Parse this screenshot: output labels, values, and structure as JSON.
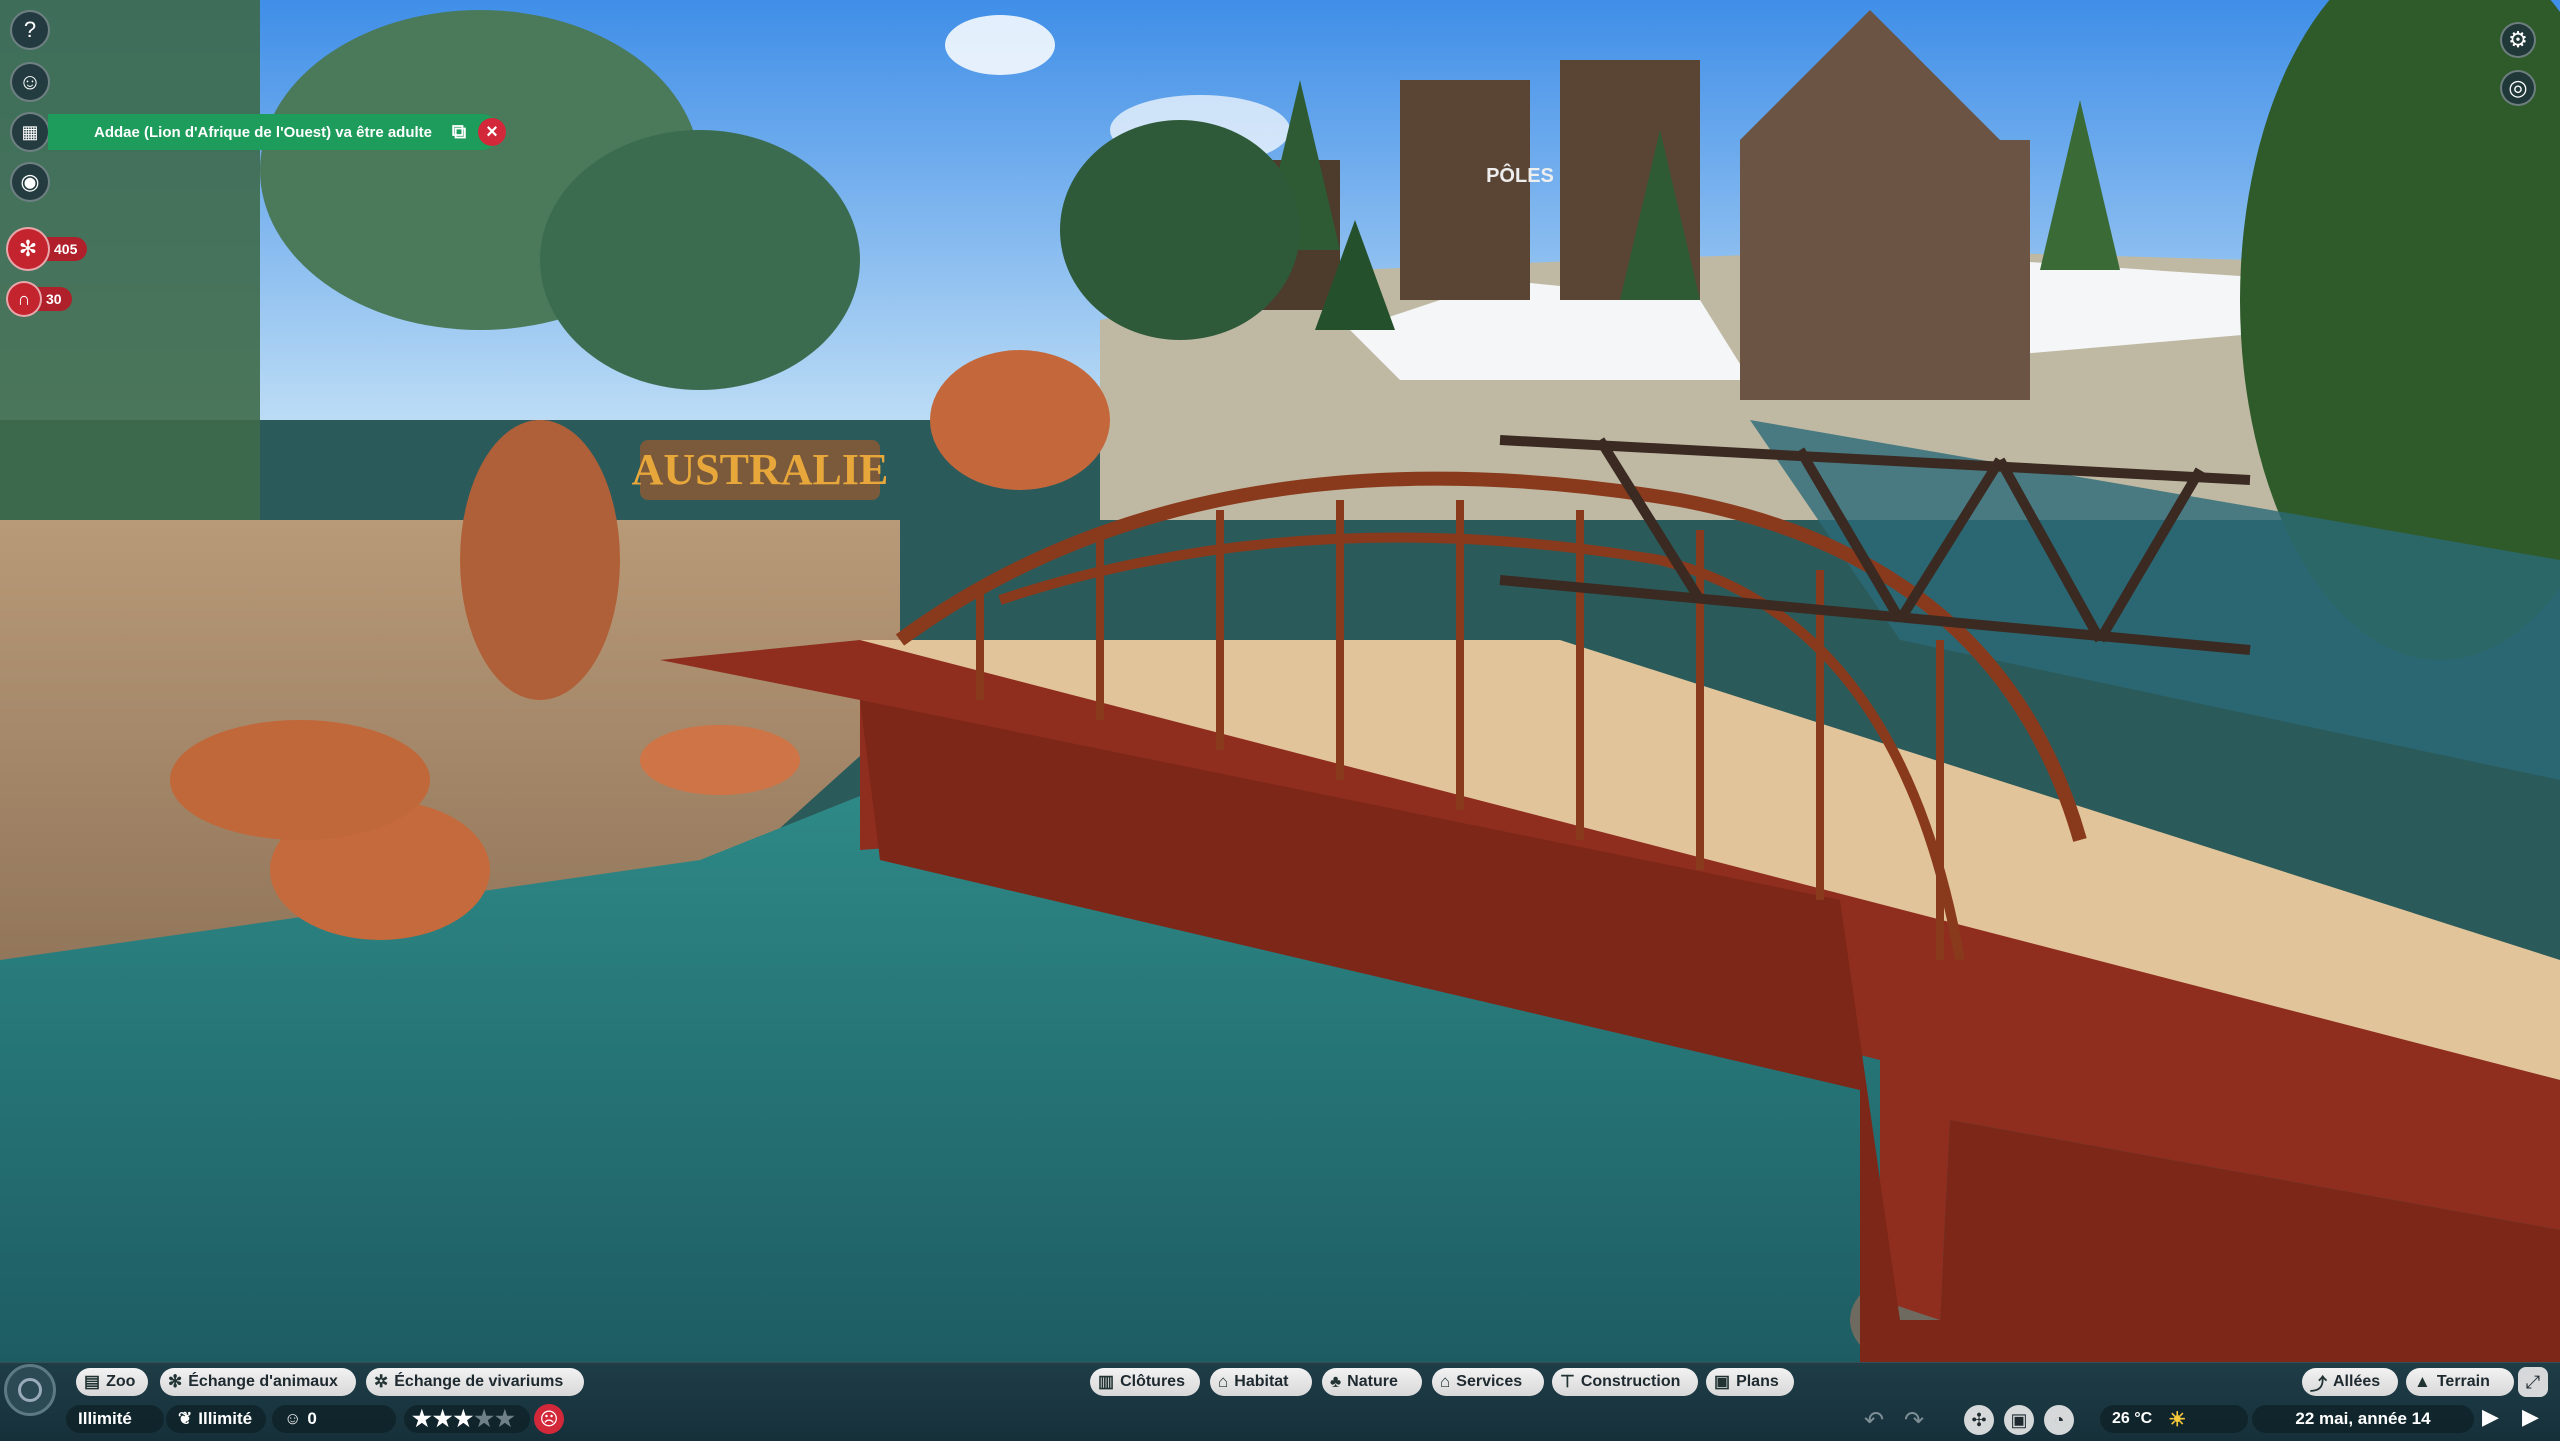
{
  "notification": {
    "text": "Addae (Lion d'Afrique de l'Ouest) va être adulte",
    "open_icon": "external-link-icon",
    "close_icon": "close-icon"
  },
  "left_icons": [
    "help-icon",
    "guest-info-icon",
    "calendar-icon",
    "visibility-icon"
  ],
  "counters": {
    "animals": "405",
    "guests": "30"
  },
  "scene_sign": "AUSTRALIE",
  "scene_sign_poles": "PÔLES",
  "top_right_icons": [
    "settings-icon",
    "camera-icon"
  ],
  "bottom_left_buttons": [
    "Zoo",
    "Échange d'animaux",
    "Échange de vivariums"
  ],
  "bottom_center_buttons": [
    "Clôtures",
    "Habitat",
    "Nature",
    "Services",
    "Construction",
    "Plans"
  ],
  "bottom_right_buttons": [
    "Allées",
    "Terrain"
  ],
  "status": {
    "money": "Illimité",
    "research": "Illimité",
    "guests": "0",
    "rating_stars": 3,
    "rating_max": 5,
    "temperature": "26 °C",
    "date": "22 mai, année 14"
  },
  "colors": {
    "notification_green": "#1e9c5c",
    "alert_red": "#c3242e",
    "bar_bg": "#1f3d47",
    "pill_bg": "#e8e8e8"
  }
}
